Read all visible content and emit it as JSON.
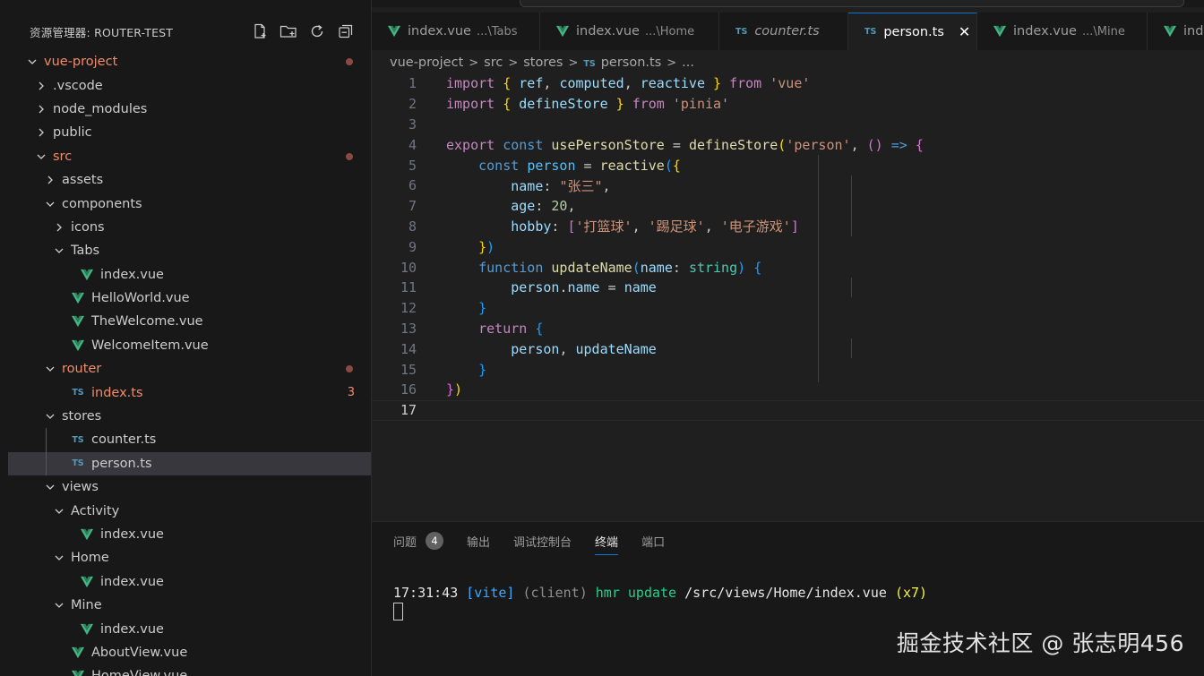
{
  "explorer": {
    "title": "资源管理器: ROUTER-TEST",
    "actions": [
      "new-file-icon",
      "new-folder-icon",
      "refresh-icon",
      "collapse-all-icon"
    ]
  },
  "tree": [
    {
      "label": "vue-project",
      "depth": 0,
      "chevron": "down",
      "icon": "",
      "color": "red",
      "dot": true
    },
    {
      "label": ".vscode",
      "depth": 1,
      "chevron": "right",
      "icon": ""
    },
    {
      "label": "node_modules",
      "depth": 1,
      "chevron": "right",
      "icon": ""
    },
    {
      "label": "public",
      "depth": 1,
      "chevron": "right",
      "icon": ""
    },
    {
      "label": "src",
      "depth": 1,
      "chevron": "down",
      "icon": "",
      "color": "red",
      "dot": true
    },
    {
      "label": "assets",
      "depth": 2,
      "chevron": "right",
      "icon": ""
    },
    {
      "label": "components",
      "depth": 2,
      "chevron": "down",
      "icon": ""
    },
    {
      "label": "icons",
      "depth": 3,
      "chevron": "right",
      "icon": ""
    },
    {
      "label": "Tabs",
      "depth": 3,
      "chevron": "down",
      "icon": ""
    },
    {
      "label": "index.vue",
      "depth": 4,
      "chevron": "",
      "icon": "vue"
    },
    {
      "label": "HelloWorld.vue",
      "depth": 3,
      "chevron": "",
      "icon": "vue"
    },
    {
      "label": "TheWelcome.vue",
      "depth": 3,
      "chevron": "",
      "icon": "vue"
    },
    {
      "label": "WelcomeItem.vue",
      "depth": 3,
      "chevron": "",
      "icon": "vue"
    },
    {
      "label": "router",
      "depth": 2,
      "chevron": "down",
      "icon": "",
      "color": "red",
      "dot": true
    },
    {
      "label": "index.ts",
      "depth": 3,
      "chevron": "",
      "icon": "ts",
      "color": "red",
      "count": "3"
    },
    {
      "label": "stores",
      "depth": 2,
      "chevron": "down",
      "icon": ""
    },
    {
      "label": "counter.ts",
      "depth": 3,
      "chevron": "",
      "icon": "ts"
    },
    {
      "label": "person.ts",
      "depth": 3,
      "chevron": "",
      "icon": "ts",
      "selected": true
    },
    {
      "label": "views",
      "depth": 2,
      "chevron": "down",
      "icon": ""
    },
    {
      "label": "Activity",
      "depth": 3,
      "chevron": "down",
      "icon": ""
    },
    {
      "label": "index.vue",
      "depth": 4,
      "chevron": "",
      "icon": "vue"
    },
    {
      "label": "Home",
      "depth": 3,
      "chevron": "down",
      "icon": ""
    },
    {
      "label": "index.vue",
      "depth": 4,
      "chevron": "",
      "icon": "vue"
    },
    {
      "label": "Mine",
      "depth": 3,
      "chevron": "down",
      "icon": ""
    },
    {
      "label": "index.vue",
      "depth": 4,
      "chevron": "",
      "icon": "vue"
    },
    {
      "label": "AboutView.vue",
      "depth": 3,
      "chevron": "",
      "icon": "vue"
    },
    {
      "label": "HomeView.vue",
      "depth": 3,
      "chevron": "",
      "icon": "vue"
    }
  ],
  "tabs": [
    {
      "label": "index.vue",
      "desc": "...\\Tabs",
      "icon": "vue"
    },
    {
      "label": "index.vue",
      "desc": "...\\Home",
      "icon": "vue"
    },
    {
      "label": "counter.ts",
      "desc": "",
      "icon": "ts",
      "italic": true
    },
    {
      "label": "person.ts",
      "desc": "",
      "icon": "ts",
      "active": true,
      "close": "✕"
    },
    {
      "label": "index.vue",
      "desc": "...\\Mine",
      "icon": "vue"
    },
    {
      "label": "inde",
      "desc": "",
      "icon": "vue"
    }
  ],
  "breadcrumb": {
    "items": [
      "vue-project",
      "src",
      "stores",
      "person.ts",
      "..."
    ],
    "separator": ">"
  },
  "editor": {
    "current_line": 17,
    "lines": [
      {
        "n": "1",
        "tokens": [
          [
            "import",
            "kc"
          ],
          [
            " ",
            ""
          ],
          [
            "{",
            "b1"
          ],
          [
            " ",
            ""
          ],
          [
            "ref",
            "v"
          ],
          [
            ", ",
            ""
          ],
          [
            "computed",
            "v"
          ],
          [
            ", ",
            ""
          ],
          [
            "reactive",
            "v"
          ],
          [
            " ",
            ""
          ],
          [
            "}",
            "b1"
          ],
          [
            " ",
            ""
          ],
          [
            "from",
            "kc"
          ],
          [
            " ",
            ""
          ],
          [
            "'vue'",
            "s"
          ]
        ]
      },
      {
        "n": "2",
        "tokens": [
          [
            "import",
            "kc"
          ],
          [
            " ",
            ""
          ],
          [
            "{",
            "b1"
          ],
          [
            " ",
            ""
          ],
          [
            "defineStore",
            "v"
          ],
          [
            " ",
            ""
          ],
          [
            "}",
            "b1"
          ],
          [
            " ",
            ""
          ],
          [
            "from",
            "kc"
          ],
          [
            " ",
            ""
          ],
          [
            "'pinia'",
            "s"
          ]
        ]
      },
      {
        "n": "3",
        "tokens": []
      },
      {
        "n": "4",
        "tokens": [
          [
            "export",
            "kc"
          ],
          [
            " ",
            ""
          ],
          [
            "const",
            "k"
          ],
          [
            " ",
            ""
          ],
          [
            "usePersonStore",
            "fn"
          ],
          [
            " = ",
            ""
          ],
          [
            "defineStore",
            "fn"
          ],
          [
            "(",
            "b1"
          ],
          [
            "'person'",
            "s"
          ],
          [
            ", ",
            ""
          ],
          [
            "()",
            "b2"
          ],
          [
            " ",
            ""
          ],
          [
            "=>",
            "k"
          ],
          [
            " ",
            ""
          ],
          [
            "{",
            "b2"
          ]
        ]
      },
      {
        "n": "5",
        "tokens": [
          [
            "    ",
            ""
          ],
          [
            "const",
            "k"
          ],
          [
            " ",
            ""
          ],
          [
            "person",
            "vc"
          ],
          [
            " = ",
            ""
          ],
          [
            "reactive",
            "fn"
          ],
          [
            "(",
            "b3"
          ],
          [
            "{",
            "b1"
          ]
        ]
      },
      {
        "n": "6",
        "tokens": [
          [
            "        ",
            ""
          ],
          [
            "name",
            "v"
          ],
          [
            ": ",
            ""
          ],
          [
            "\"张三\"",
            "s"
          ],
          [
            ",",
            ""
          ]
        ]
      },
      {
        "n": "7",
        "tokens": [
          [
            "        ",
            ""
          ],
          [
            "age",
            "v"
          ],
          [
            ": ",
            ""
          ],
          [
            "20",
            "n"
          ],
          [
            ",",
            ""
          ]
        ]
      },
      {
        "n": "8",
        "tokens": [
          [
            "        ",
            ""
          ],
          [
            "hobby",
            "v"
          ],
          [
            ": ",
            ""
          ],
          [
            "[",
            "b2"
          ],
          [
            "'打篮球'",
            "s"
          ],
          [
            ", ",
            ""
          ],
          [
            "'踢足球'",
            "s"
          ],
          [
            ", ",
            ""
          ],
          [
            "'电子游戏'",
            "s"
          ],
          [
            "]",
            "b2"
          ]
        ]
      },
      {
        "n": "9",
        "tokens": [
          [
            "    ",
            ""
          ],
          [
            "}",
            "b1"
          ],
          [
            ")",
            "b3"
          ]
        ]
      },
      {
        "n": "10",
        "tokens": [
          [
            "    ",
            ""
          ],
          [
            "function",
            "k"
          ],
          [
            " ",
            ""
          ],
          [
            "updateName",
            "fn"
          ],
          [
            "(",
            "b3"
          ],
          [
            "name",
            "v"
          ],
          [
            ": ",
            ""
          ],
          [
            "string",
            "ty"
          ],
          [
            ")",
            "b3"
          ],
          [
            " ",
            ""
          ],
          [
            "{",
            "b3"
          ]
        ]
      },
      {
        "n": "11",
        "tokens": [
          [
            "        ",
            ""
          ],
          [
            "person",
            "v"
          ],
          [
            ".",
            ""
          ],
          [
            "name",
            "v"
          ],
          [
            " = ",
            ""
          ],
          [
            "name",
            "v"
          ]
        ]
      },
      {
        "n": "12",
        "tokens": [
          [
            "    ",
            ""
          ],
          [
            "}",
            "b3"
          ]
        ]
      },
      {
        "n": "13",
        "tokens": [
          [
            "    ",
            ""
          ],
          [
            "return",
            "kc"
          ],
          [
            " ",
            ""
          ],
          [
            "{",
            "b3"
          ]
        ]
      },
      {
        "n": "14",
        "tokens": [
          [
            "        ",
            ""
          ],
          [
            "person",
            "v"
          ],
          [
            ", ",
            ""
          ],
          [
            "updateName",
            "v"
          ]
        ]
      },
      {
        "n": "15",
        "tokens": [
          [
            "    ",
            ""
          ],
          [
            "}",
            "b3"
          ]
        ]
      },
      {
        "n": "16",
        "tokens": [
          [
            "}",
            "b2"
          ],
          [
            ")",
            "b1"
          ]
        ]
      },
      {
        "n": "17",
        "tokens": []
      }
    ]
  },
  "panel": {
    "tabs": [
      {
        "label": "问题",
        "badge": "4"
      },
      {
        "label": "输出"
      },
      {
        "label": "调试控制台"
      },
      {
        "label": "终端",
        "active": true
      },
      {
        "label": "端口"
      }
    ],
    "terminal": {
      "time": "17:31:43",
      "tag": "[vite]",
      "client": "(client)",
      "hmr": "hmr update",
      "path": "/src/views/Home/index.vue",
      "count": "(x7)"
    }
  },
  "watermark": "掘金技术社区 @ 张志明456",
  "colors": {
    "accent": "#0078d4",
    "vue": "#41b883",
    "ts": "#519aba",
    "modified": "#f28b6b"
  }
}
